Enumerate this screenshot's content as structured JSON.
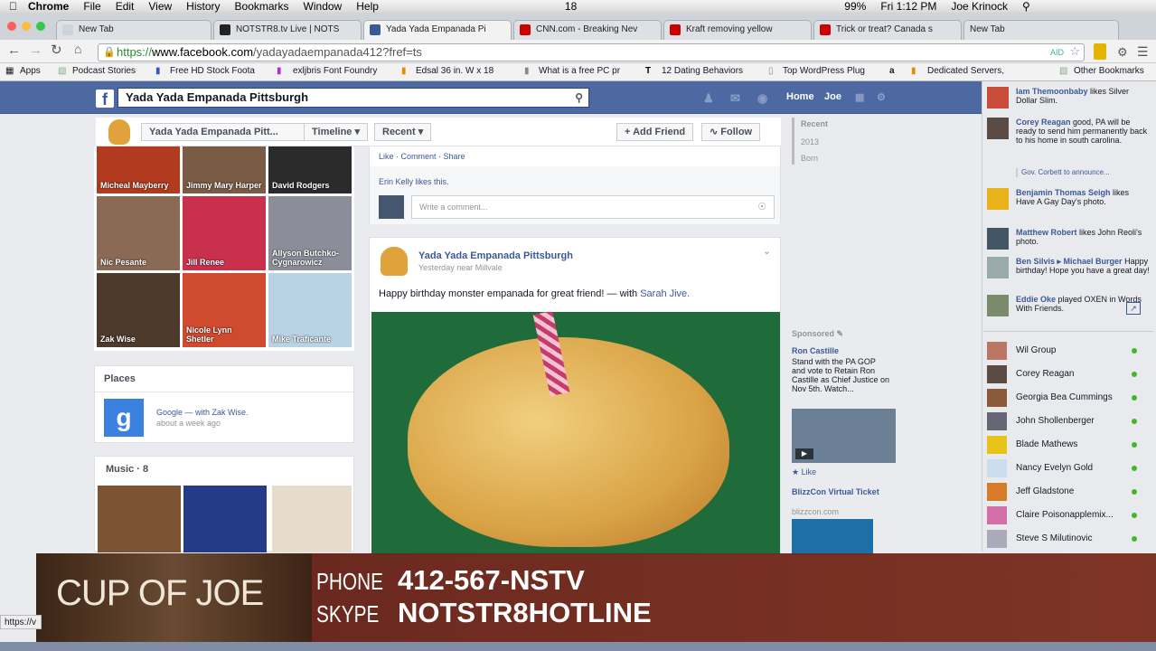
{
  "menubar": {
    "app": "Chrome",
    "items": [
      "File",
      "Edit",
      "View",
      "History",
      "Bookmarks",
      "Window",
      "Help"
    ],
    "status": {
      "badge": "18",
      "battery": "99%",
      "clock": "Fri 1:12 PM",
      "user": "Joe Krinock"
    }
  },
  "tabs": [
    {
      "label": "New Tab",
      "color": "#cfd4da"
    },
    {
      "label": "NOTSTR8.tv Live | NOTS",
      "color": "#222222"
    },
    {
      "label": "Yada Yada Empanada Pi",
      "color": "#3b5998"
    },
    {
      "label": "CNN.com - Breaking Nev",
      "color": "#cc0000"
    },
    {
      "label": "Kraft removing yellow",
      "color": "#cc0000"
    },
    {
      "label": "Trick or treat? Canada s",
      "color": "#cc0000"
    },
    {
      "label": "New Tab",
      "color": "#cfd4da"
    }
  ],
  "omnibox": {
    "url_scheme": "https://",
    "url_host": "www.facebook.com",
    "url_path": "/yadayadaempanada412?fref=ts",
    "adblock": "AID"
  },
  "bookmarks": [
    "Apps",
    "Podcast Stories",
    "Free HD Stock Foota",
    "exljbris Font Foundry",
    "Edsal 36 in. W x 18",
    "What is a free PC pr",
    "12 Dating Behaviors",
    "Top WordPress Plug",
    "a",
    "Dedicated Servers,",
    "Other Bookmarks"
  ],
  "fb": {
    "search_value": "Yada Yada Empanada Pittsburgh",
    "nav_home": "Home",
    "nav_user": "Joe",
    "page_name_pill": "Yada Yada Empanada Pitt...",
    "timeline_pill": "Timeline",
    "recent_pill": "Recent",
    "add_friend": "Add Friend",
    "follow": "Follow",
    "friends": [
      {
        "name": "Micheal Mayberry",
        "color": "#b23a1e"
      },
      {
        "name": "Jimmy Mary Harper",
        "color": "#7a5b46"
      },
      {
        "name": "David Rodgers",
        "color": "#2b2b2b"
      },
      {
        "name": "Nic Pesante",
        "color": "#8a6a55"
      },
      {
        "name": "Jill Renee",
        "color": "#c8304c"
      },
      {
        "name": "Allyson Butchko-Cygnarowicz",
        "color": "#8b8e98"
      },
      {
        "name": "Zak Wise",
        "color": "#4d3a2d"
      },
      {
        "name": "Nicole Lynn Shetler",
        "color": "#d04a2f"
      },
      {
        "name": "Mike Traficante",
        "color": "#b8d3e3"
      }
    ],
    "places_title": "Places",
    "place_text": "Google — with Zak Wise.",
    "place_time": "about a week ago",
    "music_title": "Music · 8",
    "post_actions": "Like · Comment · Share",
    "likes_text": "Erin Kelly likes this.",
    "comment_placeholder": "Write a comment...",
    "post_author": "Yada Yada Empanada Pittsburgh",
    "post_meta": "Yesterday near Millvale",
    "post_text_main": "Happy birthday monster empanada for great friend! — with ",
    "post_text_with": "Sarah Jive.",
    "timeline_years": [
      "Recent",
      "2013",
      "Born"
    ],
    "sponsored": "Sponsored",
    "ad1_title": "Ron Castille",
    "ad1_body": "Stand with the PA GOP and vote to Retain Ron Castille as Chief Justice on Nov 5th. Watch...",
    "ad1_like": "Like",
    "ad2_title": "BlizzCon Virtual Ticket",
    "ad2_url": "blizzcon.com"
  },
  "ticker": [
    {
      "name": "Iam Themoonbaby",
      "text": " likes Silver Dollar Slim."
    },
    {
      "name": "Corey Reagan",
      "text": " good, PA will be ready to send him permanently back to his home in south carolina."
    },
    {
      "name": "Benjamin Thomas Seigh",
      "text": " likes Have A Gay Day's photo."
    },
    {
      "name": "Matthew Robert",
      "text": " likes John Reoli's photo."
    },
    {
      "name": "Ben Silvis ▸ Michael Burger",
      "text": " Happy birthday! Hope you have a great day!"
    },
    {
      "name": "Eddie Oke",
      "text": " played OXEN in Words With Friends."
    }
  ],
  "ticker_sub": "Gov. Corbett to announce...",
  "chat": [
    "Wil Group",
    "Corey Reagan",
    "Georgia Bea Cummings",
    "John Shollenberger",
    "Blade Mathews",
    "Nancy Evelyn Gold",
    "Jeff Gladstone",
    "Claire Poisonapplemix...",
    "Steve S Milutinovic"
  ],
  "overlay": {
    "show": "CUP OF JOE",
    "phone_label": "PHONE",
    "phone": "412-567-NSTV",
    "skype_label": "SKYPE",
    "skype": "NOTSTR8HOTLINE"
  },
  "statusbar": "https://v"
}
